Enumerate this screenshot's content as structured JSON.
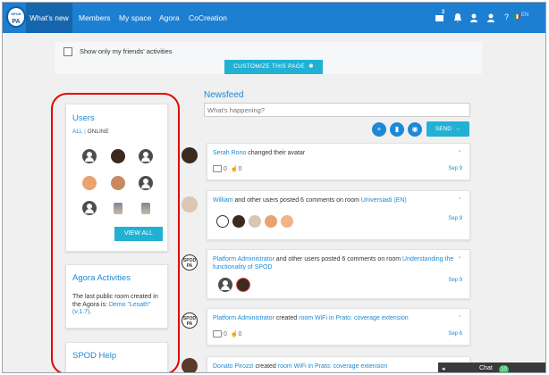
{
  "logo": {
    "line1": "SPOD",
    "line2": "PA"
  },
  "nav": {
    "items": [
      "What's new",
      "Members",
      "My space",
      "Agora",
      "CoCreation"
    ],
    "notif_count": "2",
    "help": "?",
    "lang": "EN"
  },
  "friends_filter": {
    "label": "Show only my friends' activities",
    "customize": "CUSTOMIZE THIS PAGE"
  },
  "users": {
    "title": "Users",
    "filter_all": "ALL",
    "filter_online": "ONLINE",
    "view_all": "VIEW ALL"
  },
  "agora": {
    "title": "Agora Activities",
    "text": "The last public room created in the Agora is:",
    "link": "Demo \"Lesath\" (v.1.7)",
    "suffix": "."
  },
  "help": {
    "title": "SPOD Help"
  },
  "newsfeed": {
    "title": "Newsfeed",
    "placeholder": "What's happening?",
    "send": "SEND"
  },
  "posts": [
    {
      "actor": "Serah Rono",
      "action": " changed their avatar",
      "comments": "0",
      "likes": "0",
      "date": "Sep 9"
    },
    {
      "actor": "William",
      "action": " and other users posted 6 comments on room ",
      "target": "Universiadi (EN)",
      "date": "Sep 9"
    },
    {
      "actor": "Platform Administrator",
      "action": " and other users posted 6 comments on room ",
      "target": "Understanding the functionality of SPOD",
      "date": "Sep 9"
    },
    {
      "actor": "Platform Administrator",
      "action": " created ",
      "target": "room WiFi in Prato: coverage extension",
      "comments": "0",
      "likes": "0",
      "date": "Sep 6"
    },
    {
      "actor": "Donato Pirozzi",
      "action": " created ",
      "target": "room WiFi in Prato: coverage extension"
    }
  ],
  "chat": {
    "label": "Chat",
    "count": "10"
  },
  "colors": {
    "nav": "#1c7fd1",
    "accent": "#21b1d3",
    "link": "#1c89d6",
    "highlight": "#e60000"
  }
}
